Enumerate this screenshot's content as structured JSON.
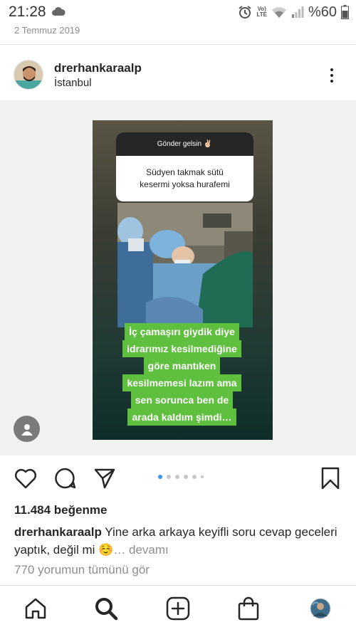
{
  "status_bar": {
    "time": "21:28",
    "battery_text": "%60",
    "network_label_top": "Vo)",
    "network_label_bottom": "LTE",
    "icons": [
      "cloud-icon",
      "alarm-icon",
      "wifi-icon",
      "signal-icon",
      "battery-icon"
    ]
  },
  "post": {
    "date": "2 Temmuz 2019",
    "username": "drerhankaraalp",
    "location": "İstanbul",
    "story": {
      "question_header": "Gönder gelsin ✌🏻",
      "question_lines": [
        "Südyen takmak  sütü",
        "kesermi yoksa hurafemi"
      ],
      "answer_lines": [
        "İç çamaşırı giydik diye",
        "idrarımız kesilmediğine",
        "göre mantıken",
        "kesilmemesi lazım ama",
        "sen sorunca ben de",
        "arada kaldım şimdi…"
      ]
    },
    "carousel": {
      "count": 6,
      "active_index": 0
    },
    "likes": "11.484 beğenme",
    "caption_user": "drerhankaraalp",
    "caption_text": " Yine arka arkaya keyifli soru cevap geceleri yaptık, değil mi ☺️",
    "caption_more": "… devamı",
    "comments_link": "770 yorumun tümünü gör"
  },
  "colors": {
    "accent_blue": "#3897f0",
    "answer_green": "#5fbf3e",
    "text_dark": "#262626",
    "text_muted": "#8e8e8e"
  },
  "bottom_nav": [
    "home-icon",
    "search-icon",
    "new-post-icon",
    "shop-icon",
    "profile-avatar"
  ]
}
